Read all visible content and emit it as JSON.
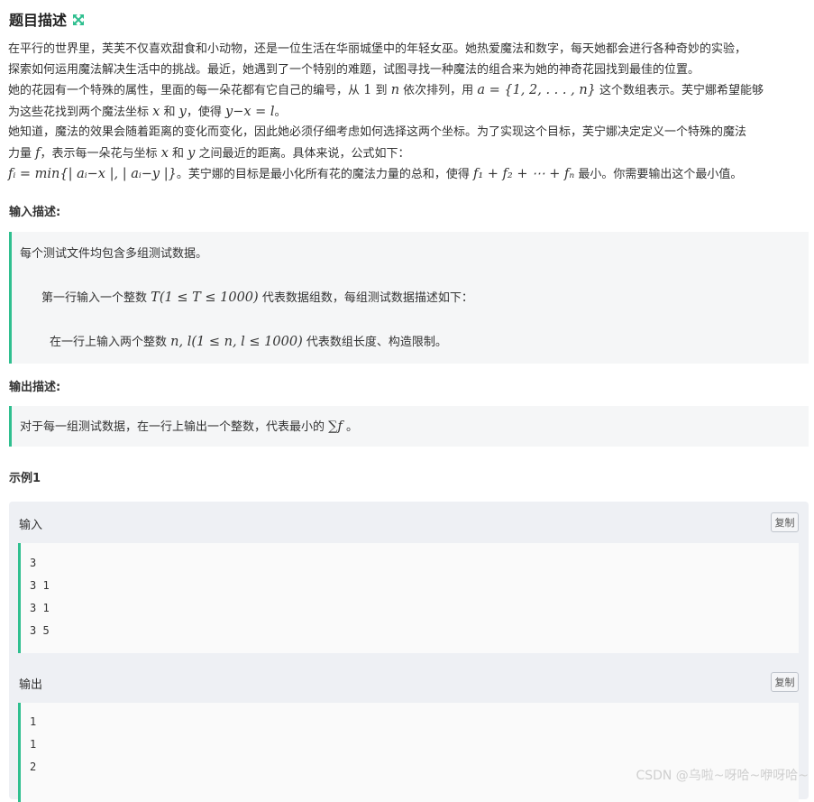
{
  "header": {
    "title": "题目描述"
  },
  "description": {
    "p1": "在平行的世界里，芙芙不仅喜欢甜食和小动物，还是一位生活在华丽城堡中的年轻女巫。她热爱魔法和数字，每天她都会进行各种奇妙的实验，",
    "p2": "探索如何运用魔法解决生活中的挑战。最近，她遇到了一个特别的难题，试图寻找一种魔法的组合来为她的神奇花园找到最佳的位置。",
    "p3a": "她的花园有一个特殊的属性，里面的每一朵花都有它自己的编号，从",
    "p3_one": "1",
    "p3b": "到",
    "p3_n": "n",
    "p3c": "依次排列，用",
    "p3_set": "a = {1, 2, . . . , n}",
    "p3d": "这个数组表示。芙宁娜希望能够",
    "p4a": "为这些花找到两个魔法坐标",
    "p4_x": "x",
    "p4b": "和",
    "p4_y": "y",
    "p4c": "，使得",
    "p4_eq": "y−x = l",
    "p4d": "。",
    "p5": "她知道，魔法的效果会随着距离的变化而变化，因此她必须仔细考虑如何选择这两个坐标。为了实现这个目标，芙宁娜决定定义一个特殊的魔法",
    "p6a": "力量",
    "p6_f": "f",
    "p6b": "，表示每一朵花与坐标",
    "p6_x": "x",
    "p6c": "和",
    "p6_y": "y",
    "p6d": "之间最近的距离。具体来说，公式如下：",
    "p7_formula": "fᵢ = min{| aᵢ−x |, | aᵢ−y |}",
    "p7a": "。芙宁娜的目标是最小化所有花的魔法力量的总和，使得",
    "p7_sum": "f₁ + f₂ + ⋯ + fₙ",
    "p7b": "最小。你需要输出这个最小值。"
  },
  "input_section": {
    "label": "输入描述:",
    "line1": "每个测试文件均包含多组测试数据。",
    "line2a": "第一行输入一个整数",
    "line2_math": "T(1 ≤ T ≤ 1000)",
    "line2b": "代表数据组数，每组测试数据描述如下：",
    "line3a": "在一行上输入两个整数",
    "line3_math": "n, l(1 ≤ n, l ≤ 1000)",
    "line3b": "代表数组长度、构造限制。"
  },
  "output_section": {
    "label": "输出描述:",
    "line1a": "对于每一组测试数据，在一行上输出一个整数，代表最小的",
    "line1_math": "∑f",
    "line1b": "。"
  },
  "example": {
    "title": "示例1",
    "input_label": "输入",
    "input_copy": "复制",
    "input_lines": [
      "3",
      "3 1",
      "3 1",
      "3 5"
    ],
    "output_label": "输出",
    "output_copy": "复制",
    "output_lines": [
      "1",
      "1",
      "2"
    ]
  },
  "watermark": "CSDN @乌啦~呀哈~咿呀哈~",
  "colors": {
    "accent": "#2fbf8f",
    "block_bg": "#f5f6f7",
    "example_bg": "#eef0f4"
  }
}
